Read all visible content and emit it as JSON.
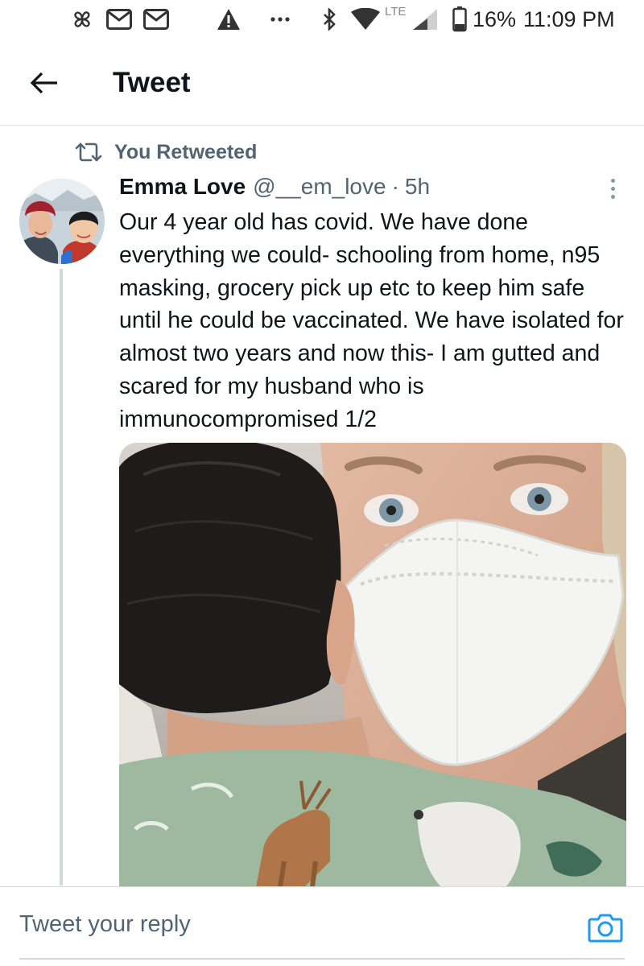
{
  "status_bar": {
    "network": "LTE",
    "battery": "16%",
    "time": "11:09 PM",
    "icons": [
      "pinwheel-icon",
      "mail-icon",
      "mail-icon",
      "alert-icon",
      "more-dots-icon",
      "bluetooth-icon",
      "wifi-icon",
      "signal-icon",
      "battery-icon"
    ]
  },
  "header": {
    "title": "Tweet",
    "back_icon": "arrow-left-icon"
  },
  "retweet_context": {
    "label": "You Retweeted",
    "icon": "retweet-icon"
  },
  "tweet": {
    "author_name": "Emma Love",
    "handle": "@__em_love",
    "separator": "·",
    "time": "5h",
    "text": "Our 4 year old has covid. We have done everything we could- schooling from home, n95 masking, grocery pick up etc to keep him safe until he could be vaccinated. We have isolated for almost two years and now this- I am gutted and scared for my husband who is immunocompromised 1/2"
  },
  "reply": {
    "placeholder": "Tweet your reply",
    "camera_icon": "camera-icon"
  },
  "colors": {
    "accent": "#1d9bf0",
    "secondary_text": "#536471",
    "divider": "#cfd9de"
  }
}
